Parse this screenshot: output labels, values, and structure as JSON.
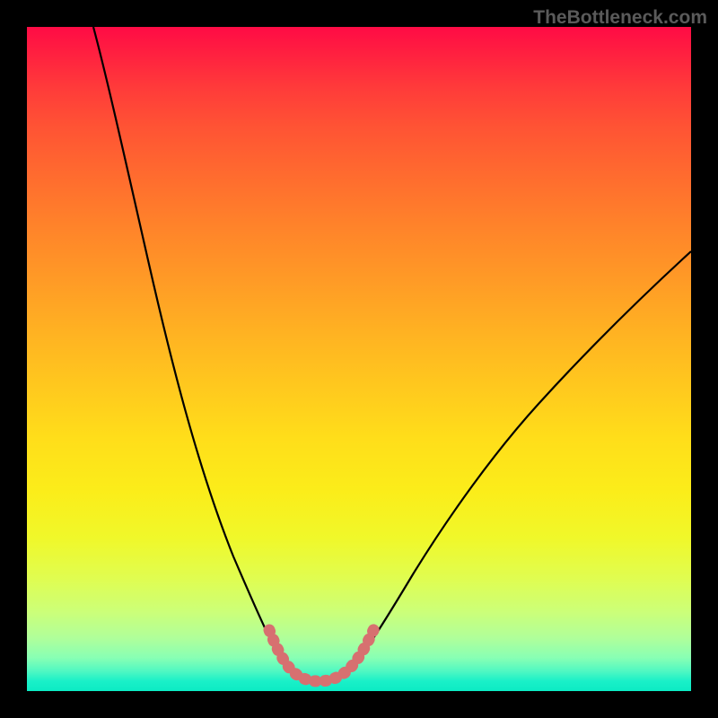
{
  "watermark": "TheBottleneck.com",
  "chart_data": {
    "type": "line",
    "title": "",
    "xlabel": "",
    "ylabel": "",
    "xlim": [
      0,
      100
    ],
    "ylim": [
      0,
      100
    ],
    "series": [
      {
        "name": "bottleneck-curve",
        "color": "#000000",
        "points": [
          {
            "x": 10,
            "y": 100
          },
          {
            "x": 12,
            "y": 92
          },
          {
            "x": 15,
            "y": 80
          },
          {
            "x": 18,
            "y": 68
          },
          {
            "x": 21,
            "y": 56
          },
          {
            "x": 24,
            "y": 45
          },
          {
            "x": 27,
            "y": 35
          },
          {
            "x": 30,
            "y": 26
          },
          {
            "x": 33,
            "y": 18
          },
          {
            "x": 36,
            "y": 11
          },
          {
            "x": 38,
            "y": 7
          },
          {
            "x": 40,
            "y": 4
          },
          {
            "x": 42,
            "y": 2
          },
          {
            "x": 44,
            "y": 1.5
          },
          {
            "x": 46,
            "y": 1.5
          },
          {
            "x": 48,
            "y": 2
          },
          {
            "x": 50,
            "y": 4
          },
          {
            "x": 52,
            "y": 7
          },
          {
            "x": 55,
            "y": 12
          },
          {
            "x": 60,
            "y": 20
          },
          {
            "x": 65,
            "y": 28
          },
          {
            "x": 70,
            "y": 35
          },
          {
            "x": 75,
            "y": 42
          },
          {
            "x": 80,
            "y": 48
          },
          {
            "x": 85,
            "y": 54
          },
          {
            "x": 90,
            "y": 59
          },
          {
            "x": 95,
            "y": 64
          },
          {
            "x": 100,
            "y": 68
          }
        ]
      },
      {
        "name": "optimal-zone-highlight",
        "color": "#d77070",
        "stroke_width": 12,
        "points": [
          {
            "x": 37,
            "y": 9
          },
          {
            "x": 39,
            "y": 5
          },
          {
            "x": 41,
            "y": 2.5
          },
          {
            "x": 43,
            "y": 1.8
          },
          {
            "x": 45,
            "y": 1.5
          },
          {
            "x": 47,
            "y": 1.8
          },
          {
            "x": 49,
            "y": 3
          },
          {
            "x": 51,
            "y": 5
          },
          {
            "x": 53,
            "y": 8
          }
        ]
      }
    ],
    "background_gradient": {
      "type": "vertical",
      "stops": [
        {
          "pos": 0,
          "color": "#ff0b45"
        },
        {
          "pos": 50,
          "color": "#ffc81e"
        },
        {
          "pos": 85,
          "color": "#e0fd50"
        },
        {
          "pos": 100,
          "color": "#0cebc4"
        }
      ]
    }
  }
}
